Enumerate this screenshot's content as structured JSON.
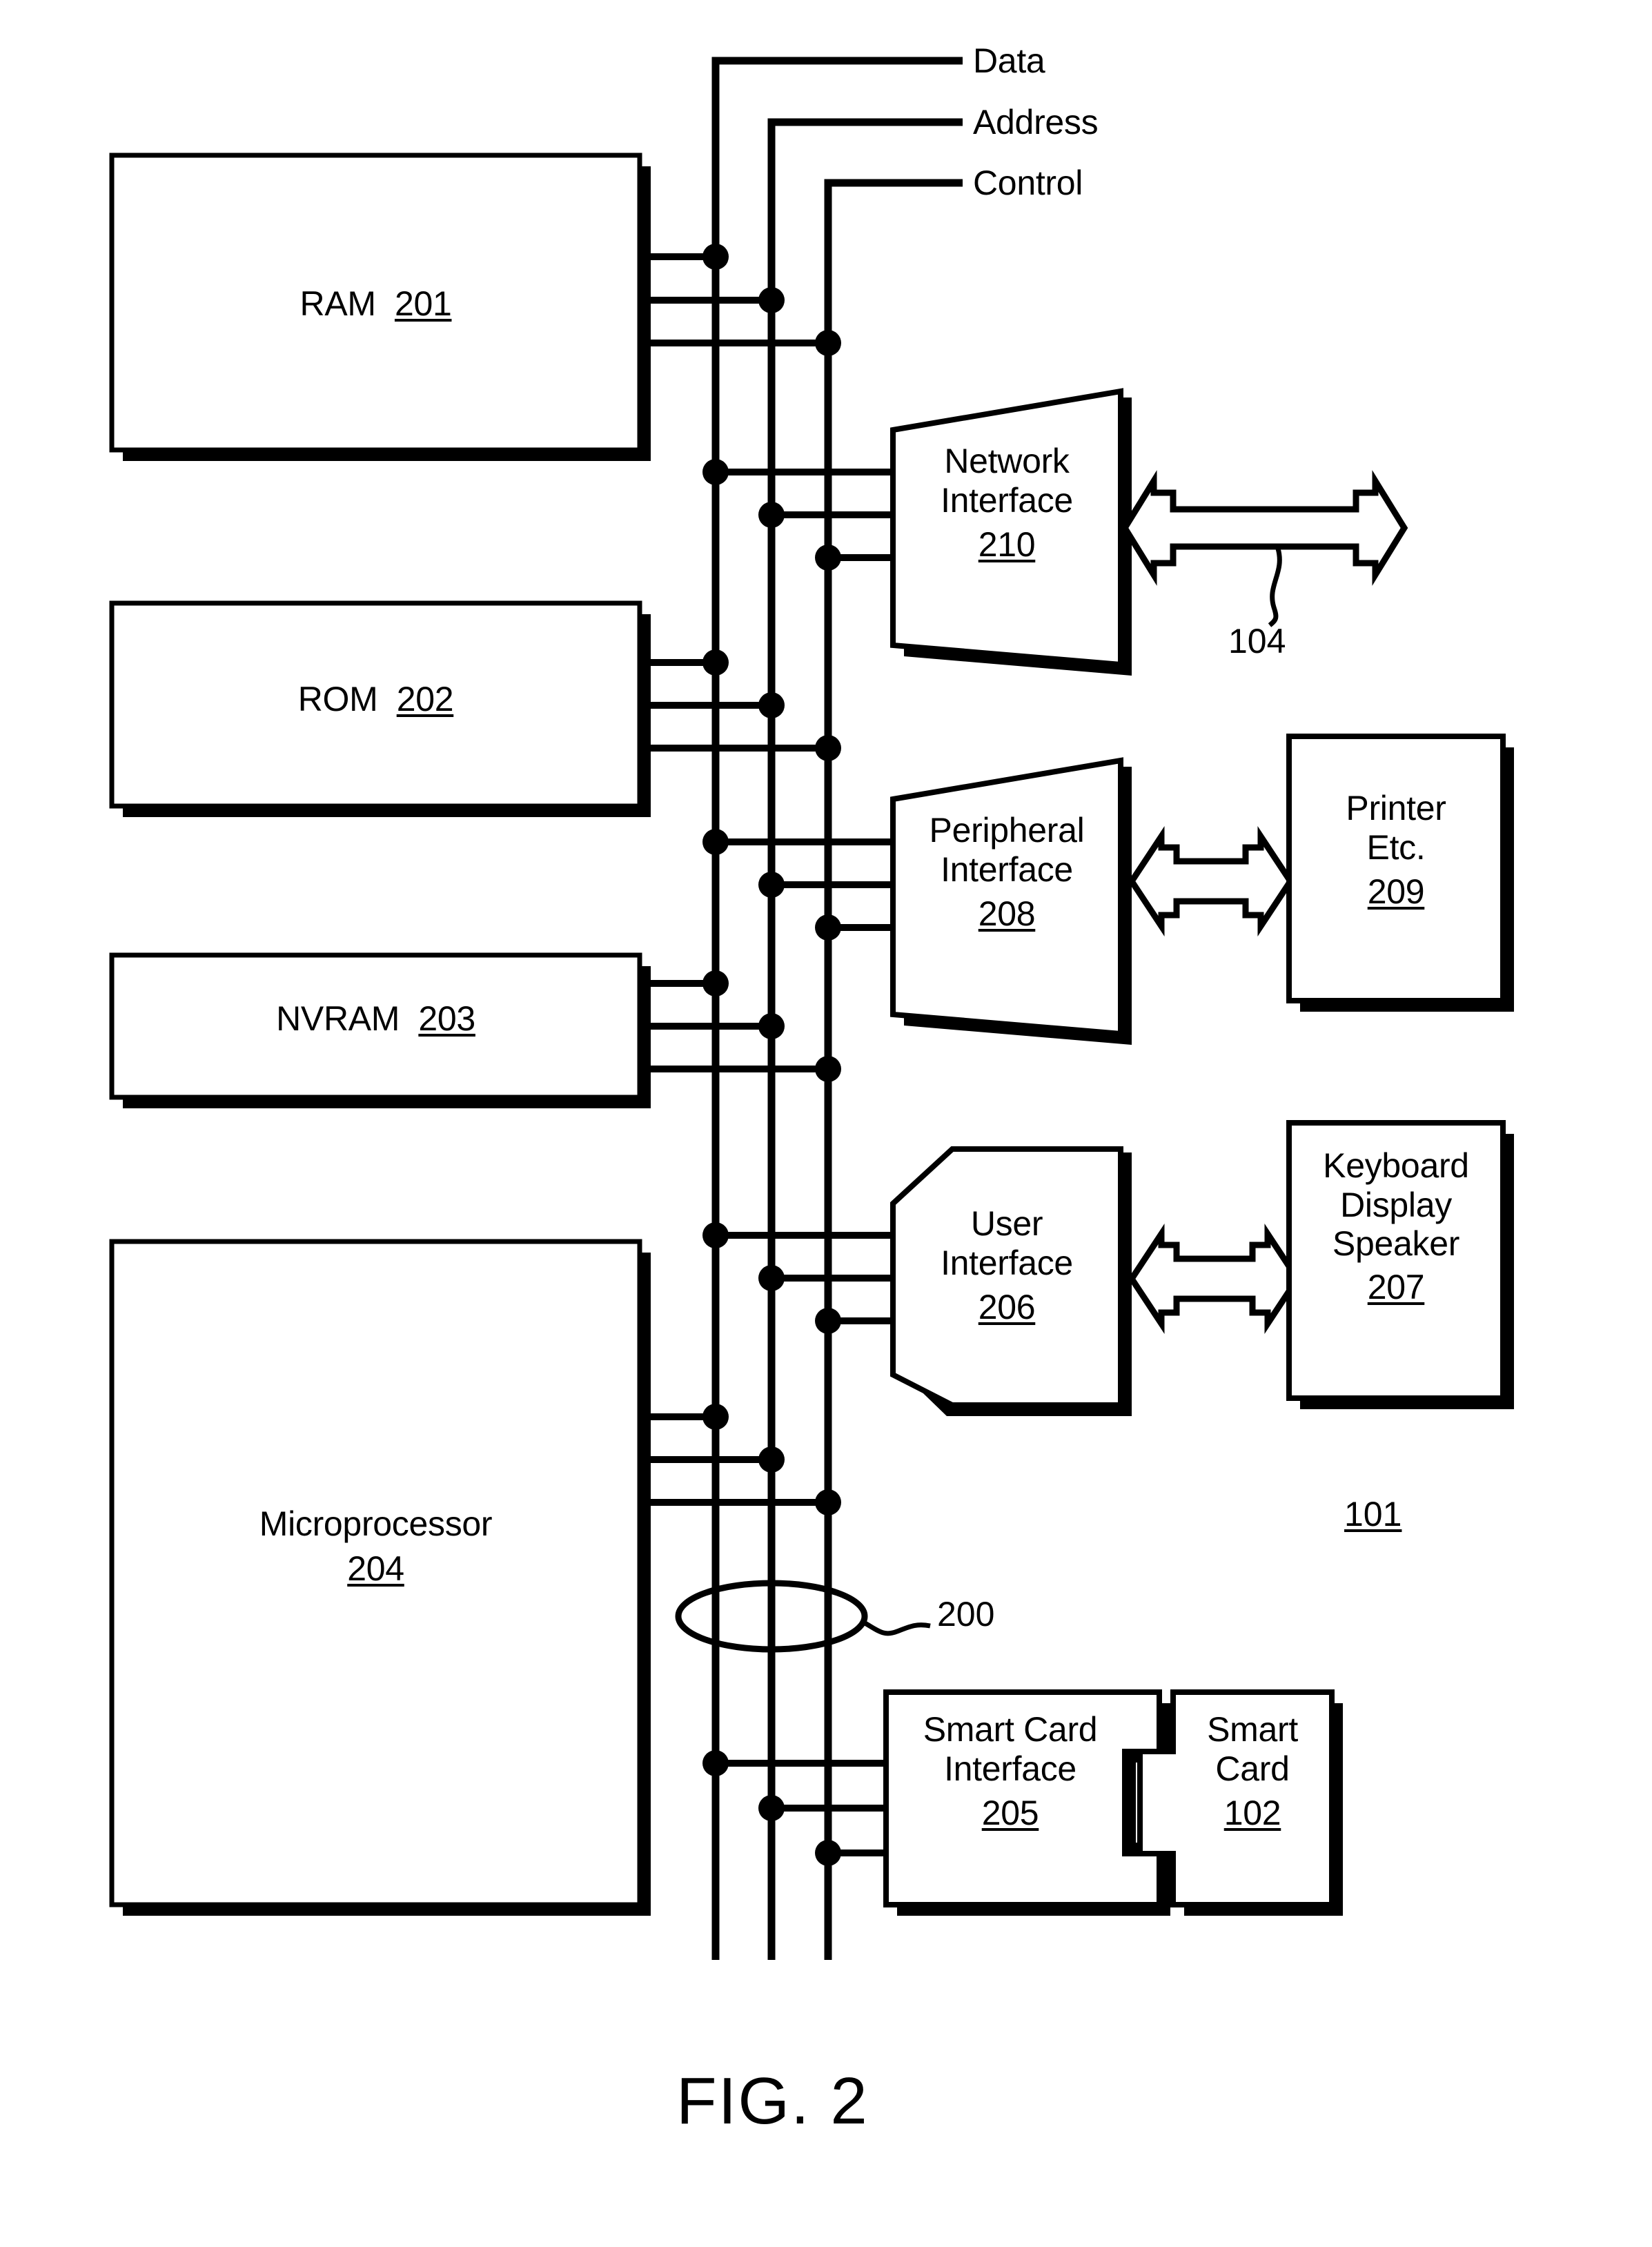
{
  "figure": {
    "caption": "FIG. 2",
    "system_ref": "101",
    "bus_ref": "200",
    "network_link_ref": "104"
  },
  "bus_labels": [
    {
      "name": "data",
      "text": "Data"
    },
    {
      "name": "address",
      "text": "Address"
    },
    {
      "name": "control",
      "text": "Control"
    }
  ],
  "blocks": {
    "ram": {
      "title": "RAM",
      "ref": "201",
      "inline": true
    },
    "rom": {
      "title": "ROM",
      "ref": "202",
      "inline": true
    },
    "nvram": {
      "title": "NVRAM",
      "ref": "203",
      "inline": true
    },
    "microprocessor": {
      "title": "Microprocessor",
      "ref": "204",
      "inline": false
    },
    "network_interface": {
      "line1": "Network",
      "line2": "Interface",
      "ref": "210"
    },
    "peripheral_interface": {
      "line1": "Peripheral",
      "line2": "Interface",
      "ref": "208"
    },
    "user_interface": {
      "line1": "User",
      "line2": "Interface",
      "ref": "206"
    },
    "smart_card_interface": {
      "line1": "Smart Card",
      "line2": "Interface",
      "ref": "205"
    },
    "printer": {
      "line1": "Printer",
      "line2": "Etc.",
      "ref": "209"
    },
    "keyboard_display_speaker": {
      "line1": "Keyboard",
      "line2": "Display",
      "line3": "Speaker",
      "ref": "207"
    },
    "smart_card": {
      "line1": "Smart",
      "line2": "Card",
      "ref": "102"
    }
  },
  "colors": {
    "ink": "#000000",
    "paper": "#ffffff"
  }
}
